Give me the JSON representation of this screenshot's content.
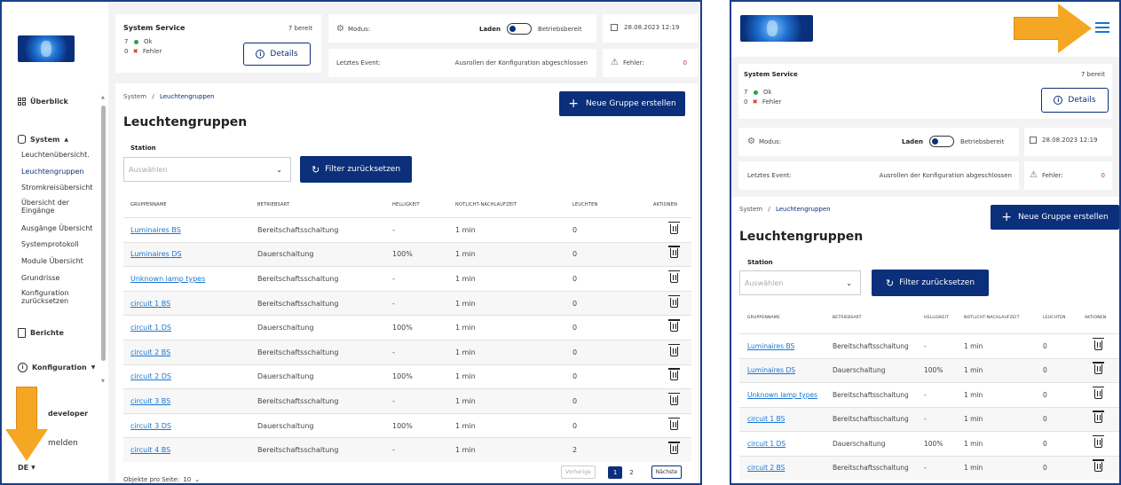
{
  "left": {
    "service": {
      "title": "System Service",
      "ready": "7 bereit",
      "ok_count": "7",
      "ok_label": "Ok",
      "err_count": "0",
      "err_label": "Fehler",
      "details": "Details"
    },
    "modus": {
      "label": "Modus:",
      "state": "Laden",
      "ready": "Betriebsbereit"
    },
    "date": "28.08.2023 12:19",
    "event": {
      "label": "Letztes Event:",
      "value": "Ausrollen der Konfiguration abgeschlossen"
    },
    "fehler": {
      "label": "Fehler:",
      "value": "0"
    },
    "sidebar": {
      "overview": "Überblick",
      "system": "System",
      "sub": [
        "Leuchtenübersicht.",
        "Leuchtengruppen",
        "Stromkreisübersicht",
        "Übersicht der Eingänge",
        "Ausgänge Übersicht",
        "Systemprotokoll",
        "Module Übersicht",
        "Grundrisse",
        "Konfiguration zurücksetzen"
      ],
      "reports": "Berichte",
      "config": "Konfiguration",
      "user": "developer",
      "logout": "melden",
      "lang": "DE"
    },
    "breadcrumb": {
      "root": "System",
      "sep": "/",
      "current": "Leuchtengruppen"
    },
    "new_group": "Neue Gruppe erstellen",
    "title": "Leuchtengruppen",
    "station_label": "Station",
    "select_placeholder": "Auswählen",
    "reset": "Filter zurücksetzen",
    "headers": [
      "GRUPPENNAME",
      "BETRIEBSART",
      "HELLIGKEIT",
      "NOTLICHT-NACHLAUFZEIT",
      "LEUCHTEN",
      "AKTIONEN"
    ],
    "rows": [
      [
        "Luminaires BS",
        "Bereitschaftsschaltung",
        "-",
        "1 min",
        "0"
      ],
      [
        "Luminaires DS",
        "Dauerschaltung",
        "100%",
        "1 min",
        "0"
      ],
      [
        "Unknown lamp types",
        "Bereitschaftsschaltung",
        "-",
        "1 min",
        "0"
      ],
      [
        "circuit 1 BS",
        "Bereitschaftsschaltung",
        "-",
        "1 min",
        "0"
      ],
      [
        "circuit 1 DS",
        "Dauerschaltung",
        "100%",
        "1 min",
        "0"
      ],
      [
        "circuit 2 BS",
        "Bereitschaftsschaltung",
        "-",
        "1 min",
        "0"
      ],
      [
        "circuit 2 DS",
        "Dauerschaltung",
        "100%",
        "1 min",
        "0"
      ],
      [
        "circuit 3 BS",
        "Bereitschaftsschaltung",
        "-",
        "1 min",
        "0"
      ],
      [
        "circuit 3 DS",
        "Dauerschaltung",
        "100%",
        "1 min",
        "0"
      ],
      [
        "circuit 4 BS",
        "Bereitschaftsschaltung",
        "-",
        "1 min",
        "2"
      ]
    ],
    "per_page_label": "Objekte pro Seite:",
    "per_page_value": "10",
    "prev": "Vorherige",
    "page1": "1",
    "page2": "2",
    "next": "Nächste"
  },
  "right": {
    "service": {
      "title": "System Service",
      "ready": "7 bereit",
      "ok_count": "7",
      "ok_label": "Ok",
      "err_count": "0",
      "err_label": "Fehler",
      "details": "Details"
    },
    "modus": {
      "label": "Modus:",
      "state": "Laden",
      "ready": "Betriebsbereit"
    },
    "date": "28.08.2023 12:19",
    "event": {
      "label": "Letztes Event:",
      "value": "Ausrollen der Konfiguration abgeschlossen"
    },
    "fehler": {
      "label": "Fehler:",
      "value": "0"
    },
    "breadcrumb": {
      "root": "System",
      "sep": "/",
      "current": "Leuchtengruppen"
    },
    "new_group": "Neue Gruppe erstellen",
    "title": "Leuchtengruppen",
    "station_label": "Station",
    "select_placeholder": "Auswählen",
    "reset": "Filter zurücksetzen",
    "headers": [
      "GRUPPENNAME",
      "BETRIEBSART",
      "HELLIGKEIT",
      "NOTLICHT-NACHLAUFZEIT",
      "LEUCHTEN",
      "AKTIONEN"
    ],
    "rows": [
      [
        "Luminaires BS",
        "Bereitschaftsschaltung",
        "-",
        "1 min",
        "0"
      ],
      [
        "Luminaires DS",
        "Dauerschaltung",
        "100%",
        "1 min",
        "0"
      ],
      [
        "Unknown lamp types",
        "Bereitschaftsschaltung",
        "-",
        "1 min",
        "0"
      ],
      [
        "circuit 1 BS",
        "Bereitschaftsschaltung",
        "-",
        "1 min",
        "0"
      ],
      [
        "circuit 1 DS",
        "Dauerschaltung",
        "100%",
        "1 min",
        "0"
      ],
      [
        "circuit 2 BS",
        "Bereitschaftsschaltung",
        "-",
        "1 min",
        "0"
      ]
    ]
  },
  "colors": {
    "accent": "#0b2f7a",
    "link": "#1976d2",
    "ok": "#2e9e4a",
    "error": "#d32f2f",
    "arrow": "#f5a623"
  }
}
